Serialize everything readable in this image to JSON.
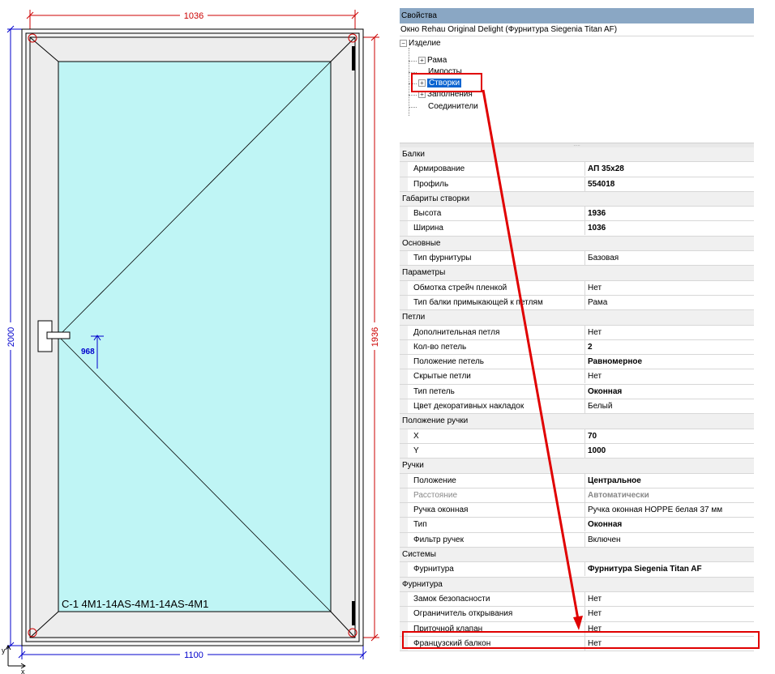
{
  "drawing": {
    "dims": {
      "top_width": "1036",
      "bottom_width": "1100",
      "left_height": "2000",
      "right_height": "1936",
      "handle_height": "968"
    },
    "glass_label": "С-1   4M1-14AS-4M1-14AS-4M1",
    "axes": {
      "y": "y",
      "x": "x"
    },
    "colors": {
      "glass": "#bff5f5",
      "frame": "#f5f5f5",
      "dim_blue": "#0000cc",
      "dim_red": "#cc0000"
    }
  },
  "panel": {
    "header": "Свойства",
    "subtitle": "Окно Rehau Original Delight (Фурнитура Siegenia Titan AF)",
    "tree": {
      "root": "Изделие",
      "nodes": [
        "Рама",
        "Импосты",
        "Створки",
        "Заполнения",
        "Соединители"
      ],
      "selected": "Створки"
    },
    "grid": [
      {
        "category": "Балки",
        "props": [
          {
            "name": "Армирование",
            "value": "АП 35x28",
            "bold": true
          },
          {
            "name": "Профиль",
            "value": "554018",
            "bold": true
          }
        ]
      },
      {
        "category": "Габариты створки",
        "props": [
          {
            "name": "Высота",
            "value": "1936",
            "bold": true
          },
          {
            "name": "Ширина",
            "value": "1036",
            "bold": true
          }
        ]
      },
      {
        "category": "Основные",
        "props": [
          {
            "name": "Тип фурнитуры",
            "value": "Базовая",
            "bold": false
          }
        ]
      },
      {
        "category": "Параметры",
        "props": [
          {
            "name": "Обмотка стрейч пленкой",
            "value": "Нет",
            "bold": false
          },
          {
            "name": "Тип балки примыкающей к петлям",
            "value": "Рама",
            "bold": false
          }
        ]
      },
      {
        "category": "Петли",
        "props": [
          {
            "name": "Дополнительная петля",
            "value": "Нет",
            "bold": false
          },
          {
            "name": "Кол-во петель",
            "value": "2",
            "bold": true
          },
          {
            "name": "Положение петель",
            "value": "Равномерное",
            "bold": true
          },
          {
            "name": "Скрытые петли",
            "value": "Нет",
            "bold": false
          },
          {
            "name": "Тип петель",
            "value": "Оконная",
            "bold": true
          },
          {
            "name": "Цвет декоративных накладок",
            "value": "Белый",
            "bold": false
          }
        ]
      },
      {
        "category": "Положение ручки",
        "props": [
          {
            "name": "X",
            "value": "70",
            "bold": true
          },
          {
            "name": "Y",
            "value": "1000",
            "bold": true
          }
        ]
      },
      {
        "category": "Ручки",
        "props": [
          {
            "name": "Положение",
            "value": "Центральное",
            "bold": true
          },
          {
            "name": "Расстояние",
            "value": "Автоматически",
            "bold": true,
            "grey": true
          },
          {
            "name": "Ручка оконная",
            "value": "Ручка оконная HOPPE белая 37 мм",
            "bold": false
          },
          {
            "name": "Тип",
            "value": "Оконная",
            "bold": true
          },
          {
            "name": "Фильтр ручек",
            "value": "Включен",
            "bold": false
          }
        ]
      },
      {
        "category": "Системы",
        "props": [
          {
            "name": "Фурнитура",
            "value": "Фурнитура Siegenia Titan AF",
            "bold": true
          }
        ]
      },
      {
        "category": "Фурнитура",
        "props": [
          {
            "name": "Замок безопасности",
            "value": "Нет",
            "bold": false
          },
          {
            "name": "Ограничитель открывания",
            "value": "Нет",
            "bold": false
          },
          {
            "name": "Приточной клапан",
            "value": "Нет",
            "bold": false
          },
          {
            "name": "Французский балкон",
            "value": "Нет",
            "bold": false
          }
        ]
      }
    ],
    "highlight_color": "#e00000"
  }
}
